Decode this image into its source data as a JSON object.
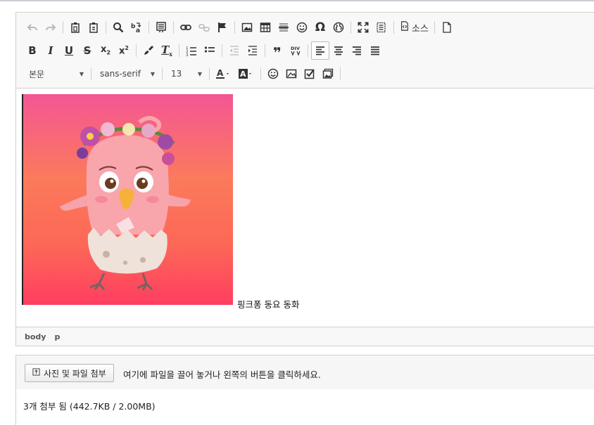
{
  "toolbar": {
    "row1": [
      {
        "name": "undo-button",
        "icon": "undo-icon",
        "state": "disabled"
      },
      {
        "name": "redo-button",
        "icon": "redo-icon",
        "state": "disabled"
      },
      {
        "name": "paste-button",
        "icon": "paste-icon"
      },
      {
        "name": "paste-text-button",
        "icon": "paste-text-icon"
      },
      {
        "name": "find-button",
        "icon": "search-icon"
      },
      {
        "name": "replace-button",
        "icon": "replace-icon"
      },
      {
        "name": "select-all-button",
        "icon": "select-all-icon"
      },
      {
        "name": "link-button",
        "icon": "link-icon"
      },
      {
        "name": "unlink-button",
        "icon": "unlink-icon",
        "state": "disabled"
      },
      {
        "name": "anchor-button",
        "icon": "flag-icon"
      },
      {
        "name": "image-button",
        "icon": "image-icon"
      },
      {
        "name": "table-button",
        "icon": "table-icon"
      },
      {
        "name": "horizontal-rule-button",
        "icon": "horizontal-rule-icon"
      },
      {
        "name": "emoji-button",
        "icon": "smiley-icon"
      },
      {
        "name": "special-char-button",
        "icon": "omega-icon"
      },
      {
        "name": "iframe-button",
        "icon": "globe-icon"
      },
      {
        "name": "maximize-button",
        "icon": "maximize-icon"
      },
      {
        "name": "show-blocks-button",
        "icon": "show-blocks-icon"
      }
    ],
    "source_label": "소스",
    "row2": [
      {
        "name": "bold-button",
        "icon": "bold-icon",
        "glyph": "B"
      },
      {
        "name": "italic-button",
        "icon": "italic-icon",
        "glyph": "I"
      },
      {
        "name": "underline-button",
        "icon": "underline-icon",
        "glyph": "U"
      },
      {
        "name": "strike-button",
        "icon": "strikethrough-icon",
        "glyph": "S"
      },
      {
        "name": "subscript-button",
        "icon": "subscript-icon",
        "glyph": "x₂"
      },
      {
        "name": "superscript-button",
        "icon": "superscript-icon",
        "glyph": "x²"
      },
      {
        "name": "copy-format-button",
        "icon": "brush-icon"
      },
      {
        "name": "remove-format-button",
        "icon": "clear-format-icon",
        "glyph": "Tx"
      },
      {
        "name": "numbered-list-button",
        "icon": "numbered-list-icon"
      },
      {
        "name": "bulleted-list-button",
        "icon": "bulleted-list-icon"
      },
      {
        "name": "outdent-button",
        "icon": "outdent-icon",
        "state": "disabled"
      },
      {
        "name": "indent-button",
        "icon": "indent-icon"
      },
      {
        "name": "blockquote-button",
        "icon": "quote-icon",
        "glyph": "❞"
      },
      {
        "name": "div-button",
        "icon": "div-container-icon"
      },
      {
        "name": "align-left-button",
        "icon": "align-left-icon",
        "state": "active"
      },
      {
        "name": "align-center-button",
        "icon": "align-center-icon"
      },
      {
        "name": "align-right-button",
        "icon": "align-right-icon"
      },
      {
        "name": "justify-button",
        "icon": "justify-icon"
      }
    ],
    "format_value": "본문",
    "font_value": "sans-serif",
    "size_value": "13",
    "row3": [
      {
        "name": "text-color-button",
        "icon": "text-color-icon"
      },
      {
        "name": "bg-color-button",
        "icon": "background-color-icon"
      },
      {
        "name": "emoticon-button",
        "icon": "smiley-icon"
      },
      {
        "name": "image-insert-button",
        "icon": "image-icon"
      },
      {
        "name": "checkbox-button",
        "icon": "checkbox-icon"
      },
      {
        "name": "image-gallery-button",
        "icon": "images-icon"
      }
    ]
  },
  "content": {
    "image_alt": "pink chick character hatching from egg",
    "caption": "핑크퐁 동요 동화"
  },
  "path_bar": [
    "body",
    "p"
  ],
  "attach": {
    "button_label": "사진 및 파일 첨부",
    "hint": "여기에 파일을 끌어 놓거나 왼쪽의 버튼을 클릭하세요.",
    "status": "3개 첨부 됨 (442.7KB / 2.00MB)"
  },
  "colors": {
    "toolbar_bg": "#f8f8f8",
    "border": "#d1d1d1",
    "image_gradient_top": "#f45694",
    "image_gradient_bottom": "#fe3e61"
  }
}
